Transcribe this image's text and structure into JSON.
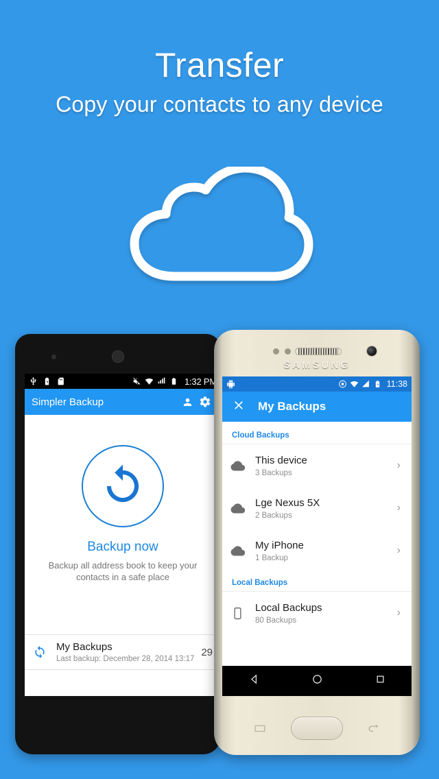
{
  "hero": {
    "title": "Transfer",
    "subtitle": "Copy your contacts to any device",
    "background_color": "#3498e8",
    "cloud_icon": "cloud-outline-icon"
  },
  "left_phone": {
    "device_style": "dark-android-phone",
    "status_bar": {
      "left_icons": [
        "usb-icon",
        "battery-charging-icon",
        "sd-card-off-icon"
      ],
      "right_icons": [
        "volume-mute-icon",
        "wifi-icon",
        "signal-icon",
        "battery-icon"
      ],
      "clock": "1:32 PM"
    },
    "app_bar": {
      "title": "Simpler Backup",
      "account_icon": "person-icon",
      "settings_icon": "gear-icon",
      "color": "#2196f3"
    },
    "main": {
      "backup_icon": "restore-circle-icon",
      "action_label": "Backup now",
      "action_description": "Backup all address book to keep your contacts in a safe place",
      "accent_color": "#1e88e5"
    },
    "list_row": {
      "icon": "sync-icon",
      "title": "My Backups",
      "subtitle": "Last backup: December 28, 2014 13:17",
      "count": "29"
    }
  },
  "right_phone": {
    "device_style": "samsung-gold-phone",
    "brand": "SAMSUNG",
    "status_bar": {
      "left_icons": [
        "android-robot-icon"
      ],
      "right_icons": [
        "sync-icon",
        "wifi-icon",
        "signal-icon",
        "battery-icon"
      ],
      "clock": "11:38"
    },
    "app_bar": {
      "close_icon": "close-icon",
      "title": "My Backups",
      "color": "#2196f3"
    },
    "sections": [
      {
        "header": "Cloud Backups",
        "items": [
          {
            "icon": "cloud-icon",
            "title": "This device",
            "subtitle": "3 Backups",
            "chevron": "chevron-right-icon"
          },
          {
            "icon": "cloud-icon",
            "title": "Lge Nexus 5X",
            "subtitle": "2 Backups",
            "chevron": "chevron-right-icon"
          },
          {
            "icon": "cloud-icon",
            "title": "My iPhone",
            "subtitle": "1 Backup",
            "chevron": "chevron-right-icon"
          }
        ]
      },
      {
        "header": "Local Backups",
        "items": [
          {
            "icon": "phone-icon",
            "title": "Local Backups",
            "subtitle": "80 Backups",
            "chevron": "chevron-right-icon"
          }
        ]
      }
    ],
    "nav_bar": {
      "back_icon": "back-triangle-icon",
      "home_icon": "home-circle-icon",
      "recents_icon": "recents-square-icon"
    },
    "hardware": {
      "home_button": "physical-home-button",
      "left_capacitive": "recents-key-icon",
      "right_capacitive": "back-key-icon"
    }
  }
}
